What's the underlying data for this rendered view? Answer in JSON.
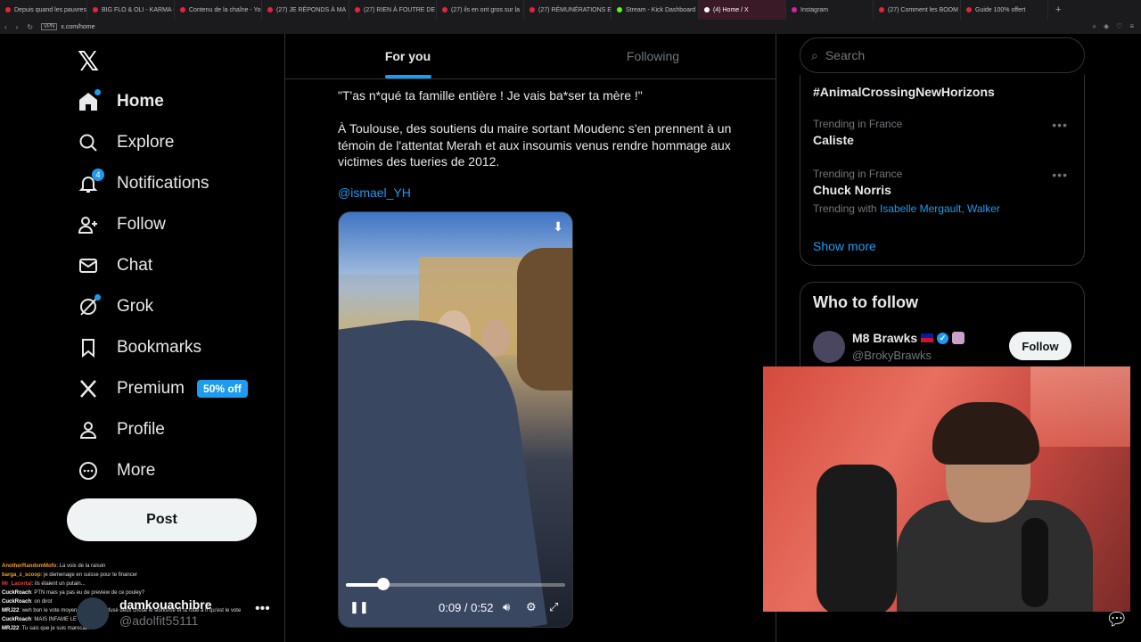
{
  "browser": {
    "tabs": [
      {
        "label": "Depuis quand les pauvres",
        "kind": "yt"
      },
      {
        "label": "BIG FLO & OLI - KARMA -",
        "kind": "yt"
      },
      {
        "label": "Contenu de la chaîne - Yo",
        "kind": "yt"
      },
      {
        "label": "(27) JE RÉPONDS À MA",
        "kind": "yt"
      },
      {
        "label": "(27) RIEN À FOUTRE DE",
        "kind": "yt"
      },
      {
        "label": "(27) ils en ont gros sur la",
        "kind": "yt"
      },
      {
        "label": "(27) RÉMUNÉRATIONS ET",
        "kind": "yt"
      },
      {
        "label": "Stream - Kick Dashboard",
        "kind": "kick"
      },
      {
        "label": "(4) Home / X",
        "kind": "x"
      },
      {
        "label": "Instagram",
        "kind": "ig"
      },
      {
        "label": "(27) Comment les BOOM",
        "kind": "yt"
      },
      {
        "label": "Guide 100% offert",
        "kind": "yt"
      }
    ],
    "url": "x.com/home",
    "vpn_label": "VPN"
  },
  "nav": {
    "items": [
      {
        "label": "Home",
        "icon": "home-icon"
      },
      {
        "label": "Explore",
        "icon": "search-icon"
      },
      {
        "label": "Notifications",
        "icon": "bell-icon",
        "badge": "4"
      },
      {
        "label": "Follow",
        "icon": "add-person-icon"
      },
      {
        "label": "Chat",
        "icon": "mail-icon"
      },
      {
        "label": "Grok",
        "icon": "grok-icon"
      },
      {
        "label": "Bookmarks",
        "icon": "bookmark-icon"
      },
      {
        "label": "Premium",
        "icon": "x-icon",
        "pill": "50% off"
      },
      {
        "label": "Profile",
        "icon": "person-icon"
      },
      {
        "label": "More",
        "icon": "more-circle-icon"
      }
    ],
    "post_label": "Post"
  },
  "account": {
    "name": "damkouachibre",
    "handle": "@adolfit55111"
  },
  "stream_chat": [
    {
      "user": "AnotherRandomMofo",
      "msg": "La voix de la raison",
      "color": "#f0a020"
    },
    {
      "user": "barga_z_scoop",
      "msg": "je demenage en suisse pour te financer",
      "color": "#f0a020"
    },
    {
      "user": "Mr_Lacertal",
      "msg": "ils étaient un putain...",
      "color": "#e04040"
    },
    {
      "user": "CuckRoach",
      "msg": "PTN mais ya pas eu de preview de ce pouley?",
      "color": "#ffffff"
    },
    {
      "user": "CuckRoach",
      "msg": "on dirot",
      "color": "#ffffff"
    },
    {
      "user": "MRJ22",
      "msg": "weh bon le vote moyen... toujours refusé deux chose le sionisme et la roue à h qu'est le vote",
      "color": "#ffffff"
    },
    {
      "user": "CuckRoach",
      "msg": "MAIS INFAME LE 1967",
      "color": "#ffffff"
    },
    {
      "user": "MRJ22",
      "msg": "Tu sais que je suis marocain ?",
      "color": "#ffffff"
    }
  ],
  "feed": {
    "tabs": [
      {
        "label": "For you",
        "selected": true
      },
      {
        "label": "Following",
        "selected": false
      }
    ],
    "tweet": {
      "line1": "\"T'as n*qué ta famille entière ! Je vais ba*ser ta mère !\"",
      "para": "À Toulouse, des soutiens du maire sortant Moudenc s'en prennent à un témoin de l'attentat Merah et aux insoumis venus rendre hommage aux victimes des tueries de 2012.",
      "mention": "@ismael_YH"
    },
    "video": {
      "time": "0:09 / 0:52",
      "progress": 0.17
    }
  },
  "sidebar": {
    "search_placeholder": "Search",
    "trends": [
      {
        "meta": "",
        "name": "#AnimalCrossingNewHorizons"
      },
      {
        "meta": "Trending in France",
        "name": "Caliste"
      },
      {
        "meta": "Trending in France",
        "name": "Chuck Norris",
        "with_label": "Trending with",
        "with_links": "Isabelle Mergault, Walker"
      }
    ],
    "show_more": "Show more",
    "who_to_follow": {
      "title": "Who to follow",
      "user": {
        "name": "M8 Brawks",
        "handle": "@BrokyBrawks",
        "button": "Follow"
      }
    }
  }
}
